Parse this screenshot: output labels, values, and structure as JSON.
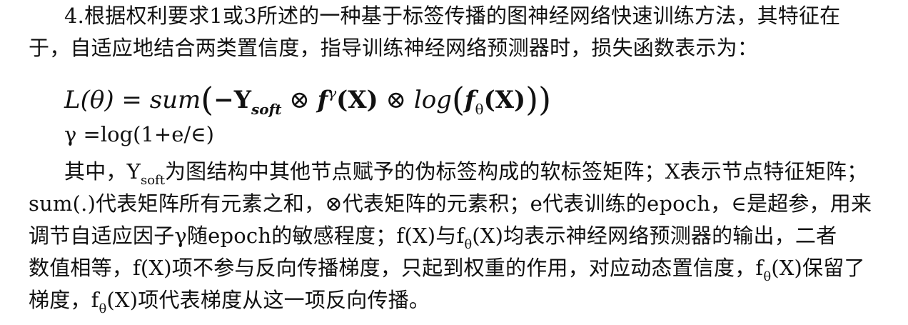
{
  "claim": {
    "line1": "4.根据权利要求1或3所述的一种基于标签传播的图神经网络快速训练方法，其特征在",
    "line2": "于，自适应地结合两类置信度，指导训练神经网络预测器时，损失函数表示为："
  },
  "formula": {
    "lhs": "L(θ) = ",
    "sum": "sum",
    "open": "(",
    "neg_y": "−Y",
    "y_sub": "soft",
    "otimes1": " ⊗ ",
    "f": "f",
    "gamma_sup": "γ",
    "fx": "(X)",
    "otimes2": " ⊗ ",
    "log": "log",
    "open2": "(",
    "f2": "f",
    "theta_sub": "θ",
    "fx2": "(X)",
    "close2": ")",
    "close": ")"
  },
  "gamma_def": "γ =log(1+e/∈)",
  "desc": {
    "l1_a": "其中，Y",
    "l1_sub": "soft",
    "l1_b": "为图结构中其他节点赋予的伪标签构成的软标签矩阵；X表示节点特征矩阵；",
    "l2": "sum(.)代表矩阵所有元素之和，⊗代表矩阵的元素积；e代表训练的epoch，∈是超参，用来",
    "l3_a": "调节自适应因子γ随epoch的敏感程度；f(X)与f",
    "l3_sub": "θ",
    "l3_b": "(X)均表示神经网络预测器的输出，二者",
    "l4_a": "数值相等，f(X)项不参与反向传播梯度，只起到权重的作用，对应动态置信度，f",
    "l4_sub": "θ",
    "l4_b": "(X)保留了",
    "l5_a": "梯度，f",
    "l5_sub": "θ",
    "l5_b": "(X)项代表梯度从这一项反向传播。"
  }
}
